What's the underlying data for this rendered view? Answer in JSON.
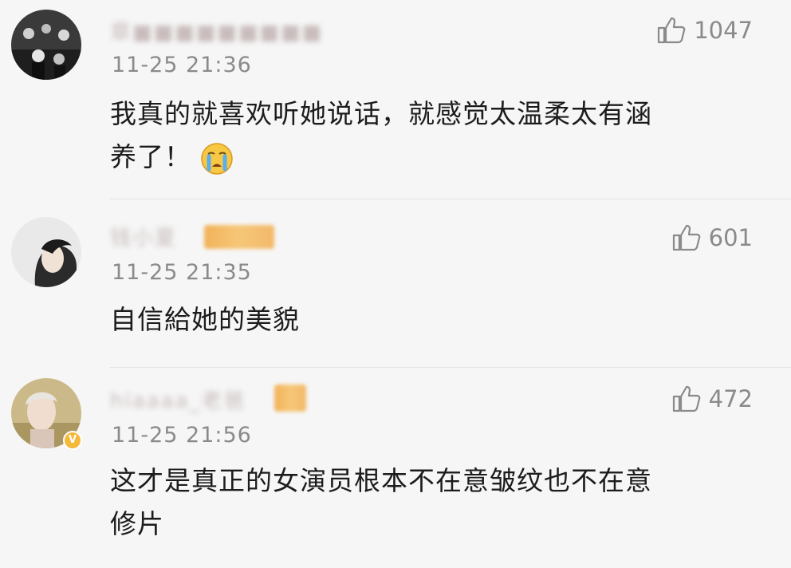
{
  "comments": [
    {
      "username": "章■■■■■■■■■",
      "time": "11-25 21:36",
      "likes": "1047",
      "text_line1": "我真的就喜欢听她说话，就感觉太温柔太有涵",
      "text_line2": "养了！",
      "emoji": "crying-face"
    },
    {
      "username": "钱小夏",
      "time": "11-25 21:35",
      "likes": "601",
      "text_line1": "自信給她的美貌"
    },
    {
      "username": "hiaaaa_老爸",
      "time": "11-25 21:56",
      "likes": "472",
      "text_line1": "这才是真正的女演员根本不在意皱纹也不在意",
      "text_line2": "修片"
    }
  ],
  "colors": {
    "background": "#f6f6f6",
    "meta": "#8a8a8a",
    "badge": "#f3b86a",
    "verified": "#f5b93a"
  },
  "icons": [
    "thumbs-up-icon",
    "crying-emoji-icon",
    "verified-badge-icon"
  ]
}
